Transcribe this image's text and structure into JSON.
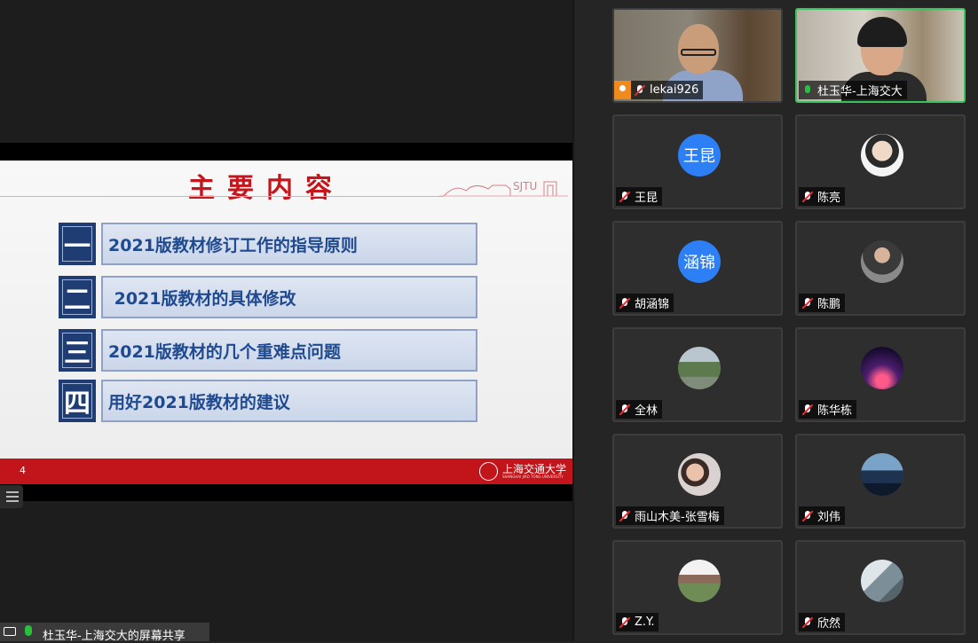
{
  "slide": {
    "title": "主要内容",
    "sjtu_text": "SJTU",
    "items": [
      {
        "num": "一",
        "text": "2021版教材修订工作的指导原则"
      },
      {
        "num": "二",
        "text": " 2021版教材的具体修改"
      },
      {
        "num": "三",
        "text": "2021版教材的几个重难点问题"
      },
      {
        "num": "四",
        "text": "用好2021版教材的建议"
      }
    ],
    "page_number": "4",
    "university_name": "上海交通大学",
    "university_sub": "SHANGHAI JIAO TONG UNIVERSITY"
  },
  "share_bar": {
    "label": "杜玉华-上海交大的屏幕共享"
  },
  "participants": [
    {
      "name": "lekai926",
      "type": "video",
      "muted": true,
      "host": true
    },
    {
      "name": "杜玉华-上海交大",
      "type": "video",
      "muted": false,
      "speaking": true
    },
    {
      "name": "王昆",
      "type": "initial",
      "initial": "王昆",
      "muted": true
    },
    {
      "name": "陈亮",
      "type": "photo",
      "muted": true
    },
    {
      "name": "胡涵锦",
      "type": "initial",
      "initial": "涵锦",
      "muted": true
    },
    {
      "name": "陈鹏",
      "type": "photo",
      "muted": true
    },
    {
      "name": "全林",
      "type": "photo",
      "muted": true
    },
    {
      "name": "陈华栋",
      "type": "photo",
      "muted": true
    },
    {
      "name": "雨山木美-张雪梅",
      "type": "photo",
      "muted": true
    },
    {
      "name": "刘伟",
      "type": "photo",
      "muted": true
    },
    {
      "name": "Z.Y.",
      "type": "photo",
      "muted": true
    },
    {
      "name": "欣然",
      "type": "photo",
      "muted": true
    }
  ],
  "colors": {
    "accent_red": "#c2151b",
    "slide_blue": "#1f3d73",
    "speaking_green": "#37c35a",
    "avatar_blue": "#2d7ff5",
    "host_orange": "#f08a1c"
  }
}
